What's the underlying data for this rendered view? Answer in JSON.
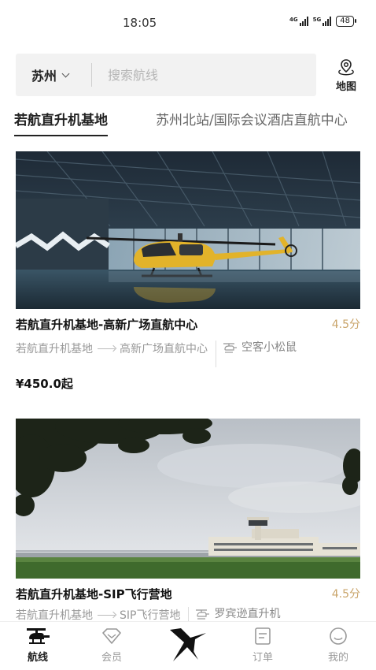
{
  "status_bar": {
    "time": "18:05",
    "network_1": "4G",
    "network_2": "5G",
    "battery": "48"
  },
  "search": {
    "city": "苏州",
    "placeholder": "搜索航线",
    "map_label": "地图",
    "map_icon": "map-pin-icon"
  },
  "tabs": [
    {
      "label": "若航直升机基地",
      "active": true
    },
    {
      "label": "苏州北站/国际会议酒店直航中心",
      "active": false
    }
  ],
  "routes": [
    {
      "title": "若航直升机基地-高新广场直航中心",
      "rating": "4.5分",
      "from": "若航直升机基地",
      "to": "高新广场直航中心",
      "aircraft": "空客小松鼠",
      "price": "¥450.0起",
      "image": "yellow-helicopter-in-hangar"
    },
    {
      "title": "若航直升机基地-SIP飞行营地",
      "rating": "4.5分",
      "from": "若航直升机基地",
      "to": "SIP飞行营地",
      "aircraft": "罗宾逊直升机",
      "image": "airfield-terminal-building"
    }
  ],
  "bottom_nav": [
    {
      "label": "航线",
      "icon": "helicopter-icon",
      "active": true
    },
    {
      "label": "会员",
      "icon": "diamond-icon",
      "active": false
    },
    {
      "label": "",
      "icon": "brand-logo-icon",
      "active": false
    },
    {
      "label": "订单",
      "icon": "order-list-icon",
      "active": false
    },
    {
      "label": "我的",
      "icon": "profile-smile-icon",
      "active": false
    }
  ],
  "colors": {
    "accent_rating": "#c9a46a",
    "search_bg": "#f2f2f2",
    "text_primary": "#222222",
    "text_muted": "#999999"
  }
}
